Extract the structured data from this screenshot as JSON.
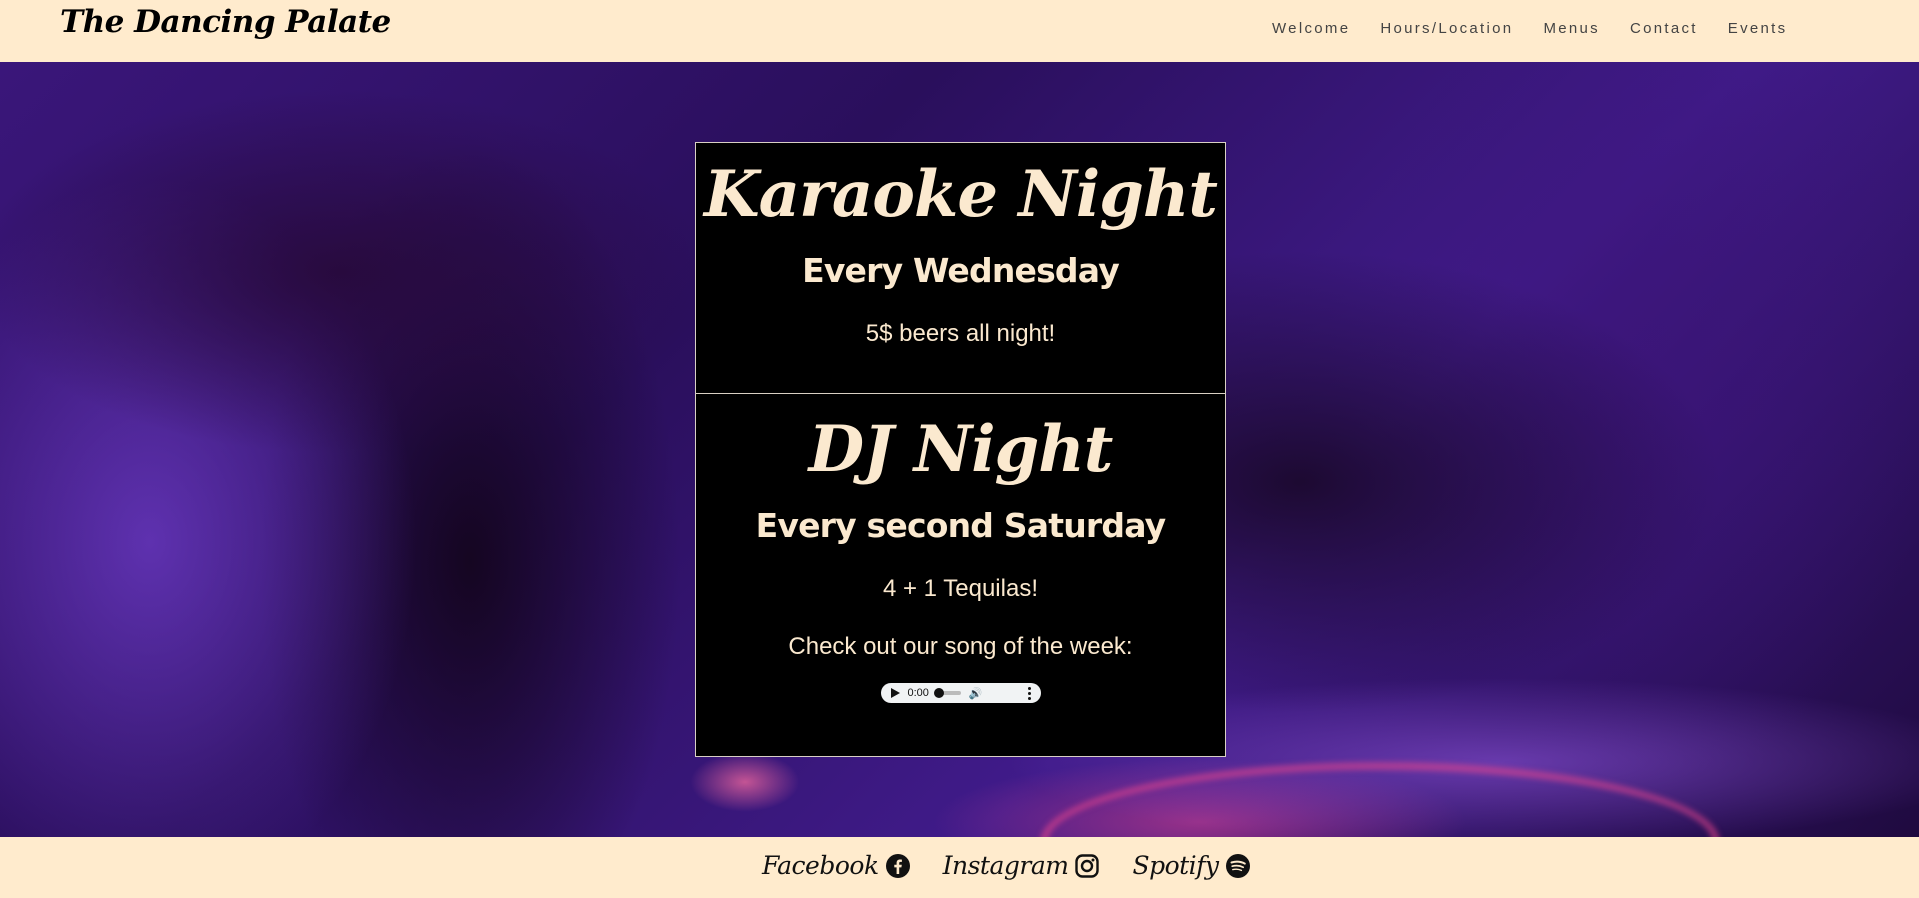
{
  "brand": {
    "name": "The Dancing Palate"
  },
  "nav": {
    "links": [
      "Welcome",
      "Hours/Location",
      "Menus",
      "Contact",
      "Events"
    ]
  },
  "events": [
    {
      "title": "Karaoke Night",
      "when": "Every Wednesday",
      "deal": "5$ beers all night!"
    },
    {
      "title": "DJ Night",
      "when": "Every second Saturday",
      "deal": "4 + 1 Tequilas!",
      "song_prompt": "Check out our song of the week:"
    }
  ],
  "audio": {
    "time": "0:00",
    "progress": 0
  },
  "footer": {
    "social": [
      {
        "label": "Facebook",
        "icon": "facebook-icon"
      },
      {
        "label": "Instagram",
        "icon": "instagram-icon"
      },
      {
        "label": "Spotify",
        "icon": "spotify-icon"
      }
    ]
  },
  "colors": {
    "bar_bg": "#ffebcd",
    "card_bg": "#000000",
    "card_text": "#fbe9cf",
    "hero_purple": "#3a167a"
  }
}
